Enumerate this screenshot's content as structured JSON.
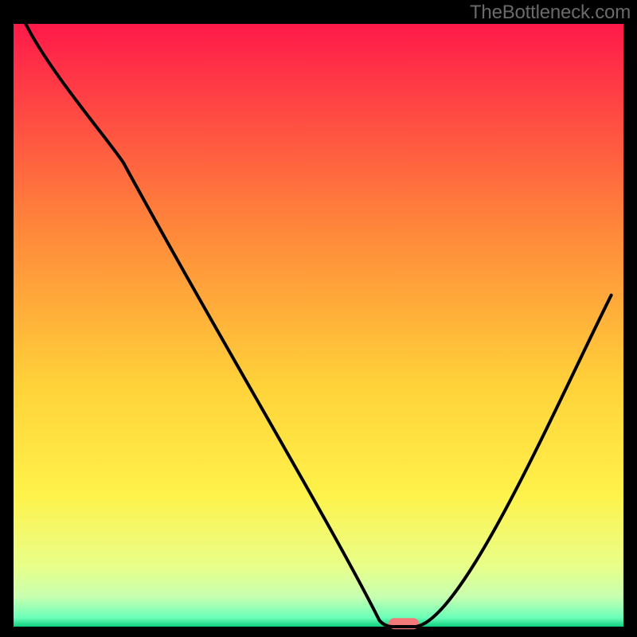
{
  "watermark": "TheBottleneck.com",
  "chart_data": {
    "type": "line",
    "title": "",
    "xlabel": "",
    "ylabel": "",
    "xlim": [
      0,
      100
    ],
    "ylim": [
      0,
      100
    ],
    "grid": false,
    "legend": false,
    "background_gradient_stops": [
      {
        "offset": 0,
        "color": "#ff1a4a"
      },
      {
        "offset": 35,
        "color": "#ff8a3a"
      },
      {
        "offset": 60,
        "color": "#ffd23a"
      },
      {
        "offset": 78,
        "color": "#fff24a"
      },
      {
        "offset": 90,
        "color": "#e8ff8a"
      },
      {
        "offset": 95,
        "color": "#c8ffb0"
      },
      {
        "offset": 98.5,
        "color": "#6cffb8"
      },
      {
        "offset": 100,
        "color": "#10d080"
      }
    ],
    "series": [
      {
        "name": "bottleneck-curve",
        "x": [
          2,
          18,
          60,
          62,
          66,
          98
        ],
        "y": [
          100,
          77,
          1,
          0,
          0,
          55
        ]
      }
    ],
    "marker": {
      "x": 64,
      "y": 0.5,
      "width_pct": 5,
      "color": "#f47a7a"
    },
    "annotations": [
      "Two-segment descending curve from top-left: steep then steeper after a knee near x≈18, reaching a flat valley bottom around x≈60–66, then rising toward the right edge at roughly half height."
    ]
  }
}
